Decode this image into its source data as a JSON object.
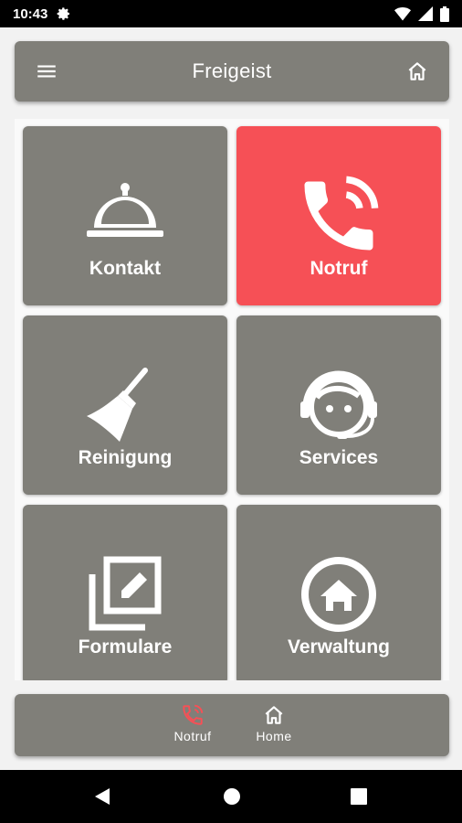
{
  "status_bar": {
    "time": "10:43"
  },
  "app_bar": {
    "title": "Freigeist"
  },
  "tiles": [
    {
      "label": "Kontakt",
      "icon": "service-bell-icon"
    },
    {
      "label": "Notruf",
      "icon": "phone-ringing-icon",
      "color": "#f65056"
    },
    {
      "label": "Reinigung",
      "icon": "broom-icon"
    },
    {
      "label": "Services",
      "icon": "headset-agent-icon"
    },
    {
      "label": "Formulare",
      "icon": "edit-documents-icon"
    },
    {
      "label": "Verwaltung",
      "icon": "home-circle-icon"
    }
  ],
  "bottom_nav": [
    {
      "label": "Notruf",
      "icon": "phone-ringing-icon",
      "active_color": "#f65056"
    },
    {
      "label": "Home",
      "icon": "home-icon"
    }
  ],
  "colors": {
    "tile": "#807f79",
    "alert": "#f65056",
    "background": "#fafafa"
  }
}
